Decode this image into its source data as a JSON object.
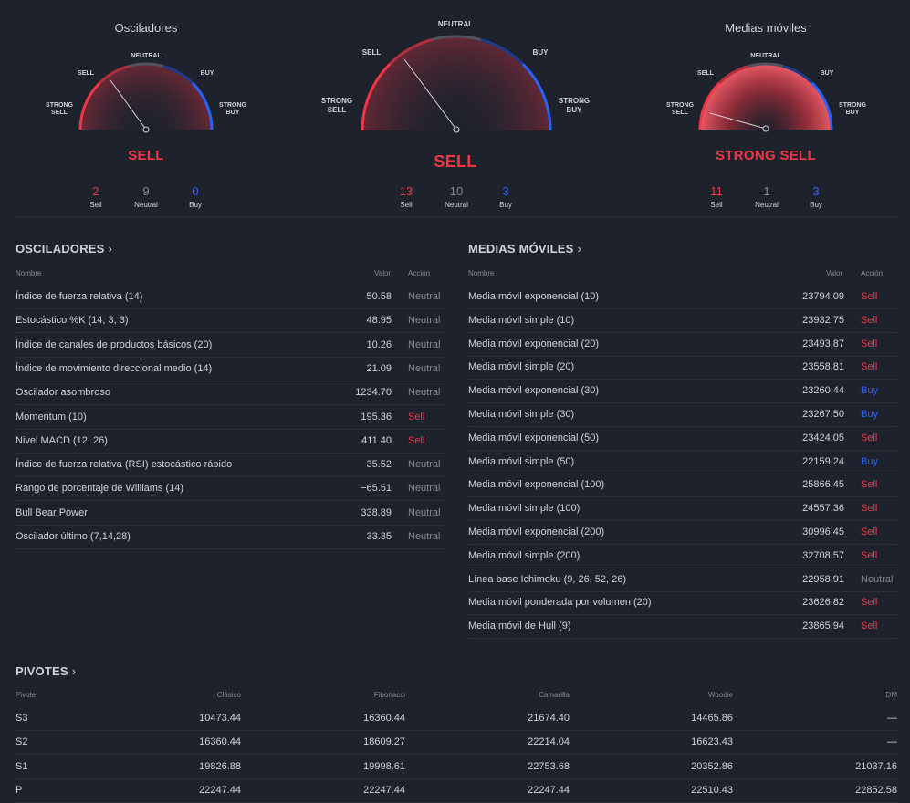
{
  "gauges": {
    "left": {
      "title": "Osciladores",
      "labels": {
        "strong_sell": "STRONG\nSELL",
        "sell": "SELL",
        "neutral": "NEUTRAL",
        "buy": "BUY",
        "strong_buy": "STRONG\nBUY"
      },
      "verdict": "SELL",
      "counts": {
        "sell": "2",
        "neutral": "9",
        "buy": "0"
      },
      "count_labels": {
        "sell": "Sell",
        "neutral": "Neutral",
        "buy": "Buy"
      }
    },
    "center": {
      "labels": {
        "strong_sell": "STRONG\nSELL",
        "sell": "SELL",
        "neutral": "NEUTRAL",
        "buy": "BUY",
        "strong_buy": "STRONG\nBUY"
      },
      "verdict": "SELL",
      "counts": {
        "sell": "13",
        "neutral": "10",
        "buy": "3"
      },
      "count_labels": {
        "sell": "Sell",
        "neutral": "Neutral",
        "buy": "Buy"
      }
    },
    "right": {
      "title": "Medias móviles",
      "labels": {
        "strong_sell": "STRONG\nSELL",
        "sell": "SELL",
        "neutral": "NEUTRAL",
        "buy": "BUY",
        "strong_buy": "STRONG\nBUY"
      },
      "verdict": "STRONG SELL",
      "counts": {
        "sell": "11",
        "neutral": "1",
        "buy": "3"
      },
      "count_labels": {
        "sell": "Sell",
        "neutral": "Neutral",
        "buy": "Buy"
      }
    }
  },
  "oscillators": {
    "title": "OSCILADORES",
    "headers": {
      "name": "Nombre",
      "value": "Valor",
      "action": "Acción"
    },
    "rows": [
      {
        "name": "Índice de fuerza relativa (14)",
        "value": "50.58",
        "action": "Neutral"
      },
      {
        "name": "Estocástico %K (14, 3, 3)",
        "value": "48.95",
        "action": "Neutral"
      },
      {
        "name": "Índice de canales de productos básicos (20)",
        "value": "10.26",
        "action": "Neutral"
      },
      {
        "name": "Índice de movimiento direccional medio (14)",
        "value": "21.09",
        "action": "Neutral"
      },
      {
        "name": "Oscilador asombroso",
        "value": "1234.70",
        "action": "Neutral"
      },
      {
        "name": "Momentum (10)",
        "value": "195.36",
        "action": "Sell"
      },
      {
        "name": "Nivel MACD (12, 26)",
        "value": "411.40",
        "action": "Sell"
      },
      {
        "name": "Índice de fuerza relativa (RSI) estocástico rápido",
        "value": "35.52",
        "action": "Neutral"
      },
      {
        "name": "Rango de porcentaje de Williams (14)",
        "value": "−65.51",
        "action": "Neutral"
      },
      {
        "name": "Bull Bear Power",
        "value": "338.89",
        "action": "Neutral"
      },
      {
        "name": "Oscilador último (7,14,28)",
        "value": "33.35",
        "action": "Neutral"
      }
    ]
  },
  "moving_averages": {
    "title": "MEDIAS MÓVILES",
    "headers": {
      "name": "Nombre",
      "value": "Valor",
      "action": "Acción"
    },
    "rows": [
      {
        "name": "Media móvil exponencial (10)",
        "value": "23794.09",
        "action": "Sell"
      },
      {
        "name": "Media móvil simple (10)",
        "value": "23932.75",
        "action": "Sell"
      },
      {
        "name": "Media móvil exponencial (20)",
        "value": "23493.87",
        "action": "Sell"
      },
      {
        "name": "Media móvil simple (20)",
        "value": "23558.81",
        "action": "Sell"
      },
      {
        "name": "Media móvil exponencial (30)",
        "value": "23260.44",
        "action": "Buy"
      },
      {
        "name": "Media móvil simple (30)",
        "value": "23267.50",
        "action": "Buy"
      },
      {
        "name": "Media móvil exponencial (50)",
        "value": "23424.05",
        "action": "Sell"
      },
      {
        "name": "Media móvil simple (50)",
        "value": "22159.24",
        "action": "Buy"
      },
      {
        "name": "Media móvil exponencial (100)",
        "value": "25866.45",
        "action": "Sell"
      },
      {
        "name": "Media móvil simple (100)",
        "value": "24557.36",
        "action": "Sell"
      },
      {
        "name": "Media móvil exponencial (200)",
        "value": "30996.45",
        "action": "Sell"
      },
      {
        "name": "Media móvil simple (200)",
        "value": "32708.57",
        "action": "Sell"
      },
      {
        "name": "Línea base Ichimoku (9, 26, 52, 26)",
        "value": "22958.91",
        "action": "Neutral"
      },
      {
        "name": "Media móvil ponderada por volumen (20)",
        "value": "23626.82",
        "action": "Sell"
      },
      {
        "name": "Media móvil de Hull (9)",
        "value": "23865.94",
        "action": "Sell"
      }
    ]
  },
  "pivots": {
    "title": "PIVOTES",
    "headers": {
      "pivot": "Pivote",
      "classic": "Clásico",
      "fibonacci": "Fibonacci",
      "camarilla": "Camarilla",
      "woodie": "Woodie",
      "dm": "DM"
    },
    "rows": [
      {
        "pivot": "S3",
        "classic": "10473.44",
        "fibonacci": "16360.44",
        "camarilla": "21674.40",
        "woodie": "14465.86",
        "dm": "—"
      },
      {
        "pivot": "S2",
        "classic": "16360.44",
        "fibonacci": "18609.27",
        "camarilla": "22214.04",
        "woodie": "16623.43",
        "dm": "—"
      },
      {
        "pivot": "S1",
        "classic": "19826.88",
        "fibonacci": "19998.61",
        "camarilla": "22753.68",
        "woodie": "20352.86",
        "dm": "21037.16"
      },
      {
        "pivot": "P",
        "classic": "22247.44",
        "fibonacci": "22247.44",
        "camarilla": "22247.44",
        "woodie": "22510.43",
        "dm": "22852.58"
      }
    ]
  },
  "colors": {
    "sell": "#f23645",
    "buy": "#2962ff",
    "neutral": "#868993",
    "background": "#1e222d"
  }
}
